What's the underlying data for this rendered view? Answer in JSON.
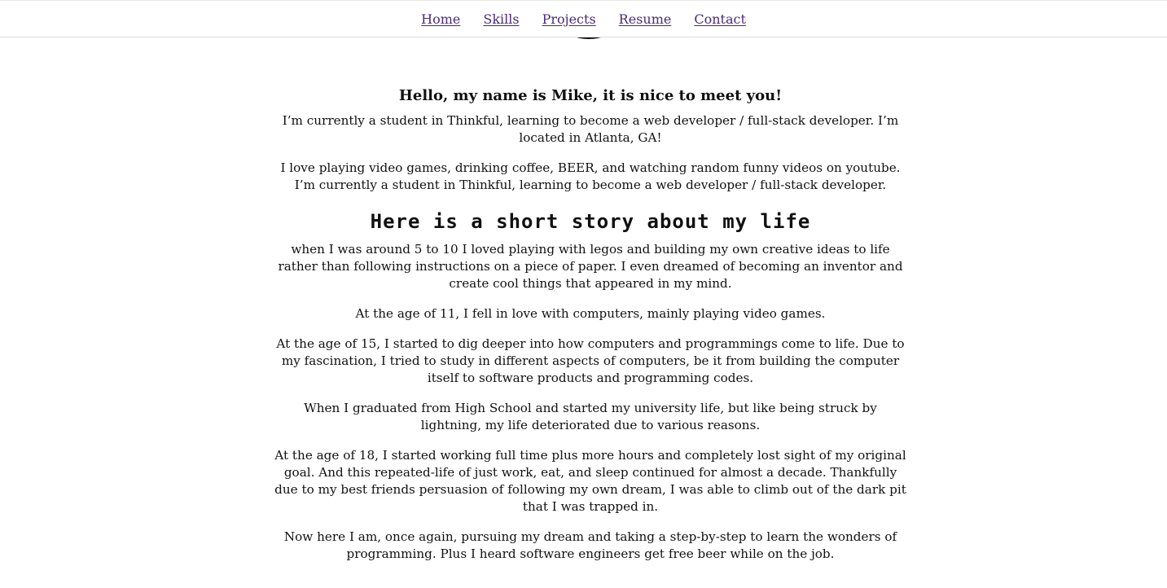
{
  "nav": {
    "items": [
      {
        "label": "Home"
      },
      {
        "label": "Skills"
      },
      {
        "label": "Projects"
      },
      {
        "label": "Resume"
      },
      {
        "label": "Contact"
      }
    ]
  },
  "intro": {
    "greeting": "Hello, my name is Mike, it is nice to meet you!",
    "paragraphs": [
      "I’m currently a student in Thinkful, learning to become a web developer / full-stack developer. I’m located in Atlanta, GA!",
      "I love playing video games, drinking coffee, BEER, and watching random funny videos on youtube. I’m currently a student in Thinkful, learning to become a web developer / full-stack developer."
    ]
  },
  "story": {
    "heading": "Here is a short story about my life",
    "paragraphs": [
      "when I was around 5 to 10 I loved playing with legos and building my own creative ideas to life rather than following instructions on a piece of paper. I even dreamed of becoming an inventor and create cool things that appeared in my mind.",
      "At the age of 11, I fell in love with computers, mainly playing video games.",
      "At the age of 15, I started to dig deeper into how computers and programmings come to life. Due to my fascination, I tried to study in different aspects of computers, be it from building the computer itself to software products and programming codes.",
      "When I graduated from High School and started my university life, but like being struck by lightning, my life deteriorated due to various reasons.",
      "At the age of 18, I started working full time plus more hours and completely lost sight of my original goal. And this repeated-life of just work, eat, and sleep continued for almost a decade. Thankfully due to my best friends persuasion of following my own dream, I was able to climb out of the dark pit that I was trapped in.",
      "Now here I am, once again, pursuing my dream and taking a step-by-step to learn the wonders of programming. Plus I heard software engineers get free beer while on the job."
    ]
  },
  "colors": {
    "link": "#4b2a7a",
    "text": "#111111",
    "background": "#ffffff"
  }
}
